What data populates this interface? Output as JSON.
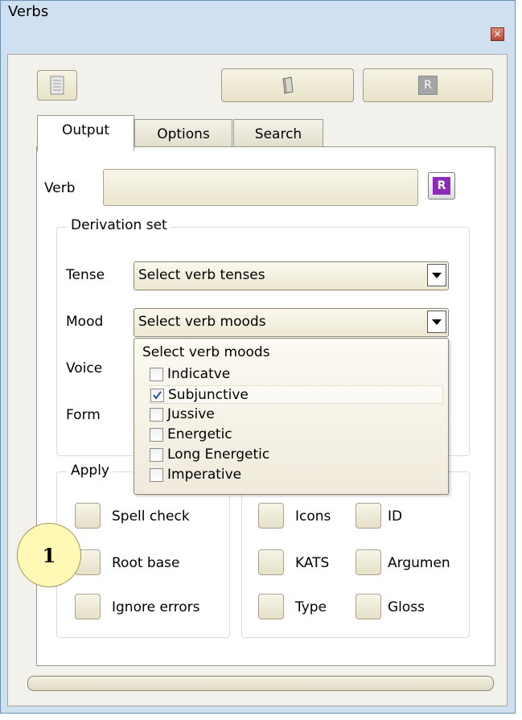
{
  "window": {
    "title": "Verbs",
    "close_glyph": "×"
  },
  "toolbar": {
    "right_button_glyph": "R"
  },
  "tabs": [
    "Output",
    "Options",
    "Search"
  ],
  "verb": {
    "label": "Verb",
    "value": "",
    "button_glyph": "R"
  },
  "derivation": {
    "legend": "Derivation set",
    "tense_label": "Tense",
    "tense_value": "Select verb tenses",
    "mood_label": "Mood",
    "mood_value": "Select verb moods",
    "voice_label": "Voice",
    "form_label": "Form"
  },
  "mood_dropdown": {
    "title": "Select verb moods",
    "items": [
      {
        "label": "Indicatve",
        "checked": false
      },
      {
        "label": "Subjunctive",
        "checked": true
      },
      {
        "label": "Jussive",
        "checked": false
      },
      {
        "label": "Energetic",
        "checked": false
      },
      {
        "label": "Long Energetic",
        "checked": false
      },
      {
        "label": "Imperative",
        "checked": false
      }
    ]
  },
  "apply": {
    "legend": "Apply",
    "options": [
      "Spell check",
      "Root base",
      "Ignore errors"
    ]
  },
  "display": {
    "options": [
      "Icons",
      "ID",
      "KATS",
      "Argumen",
      "Type",
      "Gloss"
    ]
  },
  "callout": {
    "number": "1"
  },
  "colors": {
    "purple_button": "#8b2bb8",
    "title_bar": "#cfe0f1"
  }
}
